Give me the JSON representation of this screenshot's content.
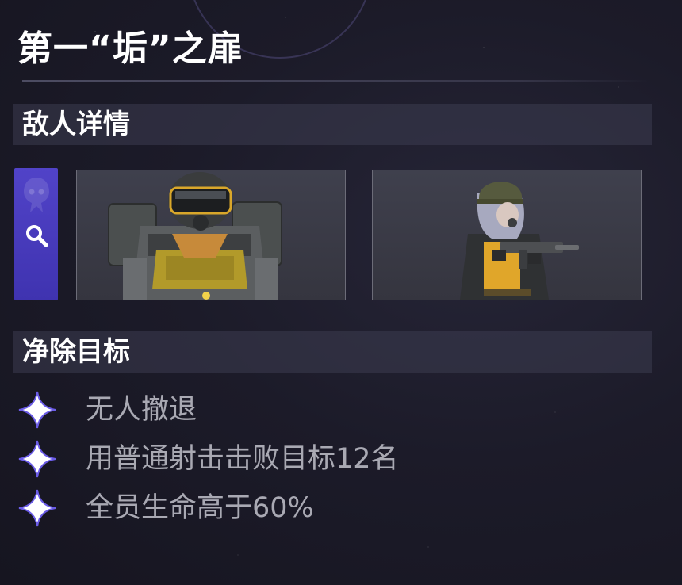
{
  "stage": {
    "title": "第一“垢”之扉"
  },
  "sections": {
    "enemies_header": "敌人详情",
    "objectives_header": "净除目标"
  },
  "enemies": [
    {
      "icon": "heavy-armored-soldier-portrait"
    },
    {
      "icon": "helmeted-gunner-portrait"
    }
  ],
  "objectives": [
    {
      "text": "无人撤退",
      "icon": "four-point-star-icon"
    },
    {
      "text": "用普通射击击败目标12名",
      "icon": "four-point-star-icon"
    },
    {
      "text": "全员生命高于60%",
      "icon": "four-point-star-icon"
    }
  ],
  "colors": {
    "accent": "#4a3ec0",
    "background": "#1c1b29",
    "header_bar": "#3c3c50",
    "objective_text": "#a9a9b3",
    "star": "#ffffff"
  }
}
